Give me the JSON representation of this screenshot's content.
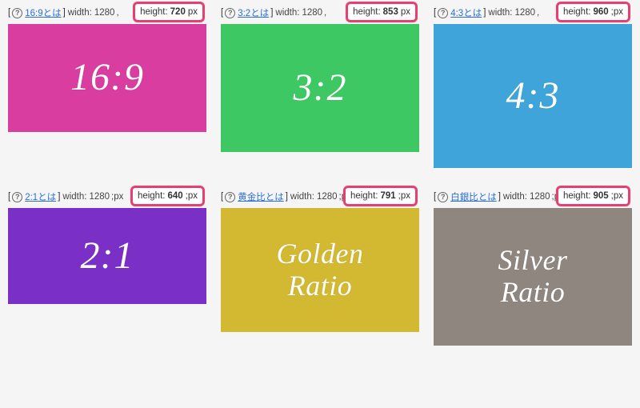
{
  "help_glyph": "?",
  "labels": {
    "width": "width:",
    "height": "height:",
    "px": "px",
    "px_sc": ";px"
  },
  "width_value": "1280",
  "cards": [
    {
      "id": "169",
      "link": "16:9とは",
      "height": "720",
      "unit": "px",
      "sep": ",",
      "title": "16:9",
      "cls": "c-169",
      "multi": false
    },
    {
      "id": "32",
      "link": "3:2とは",
      "height": "853",
      "unit": "px",
      "sep": ",",
      "title": "3:2",
      "cls": "c-32",
      "multi": false
    },
    {
      "id": "43",
      "link": "4:3とは",
      "height": "960",
      "unit": ";px",
      "sep": ",",
      "title": "4:3",
      "cls": "c-43",
      "multi": false
    },
    {
      "id": "21",
      "link": "2:1とは",
      "height": "640",
      "unit": ";px",
      "sep": ";px",
      "title": "2:1",
      "cls": "c-21",
      "multi": false
    },
    {
      "id": "gold",
      "link": "黄金比とは",
      "height": "791",
      "unit": ";px",
      "sep": ";px",
      "title": "Golden\nRatio",
      "cls": "c-gold",
      "multi": true
    },
    {
      "id": "silv",
      "link": "白銀比とは",
      "height": "905",
      "unit": ";px",
      "sep": ";px",
      "title": "Silver\nRatio",
      "cls": "c-silv",
      "multi": true
    }
  ]
}
